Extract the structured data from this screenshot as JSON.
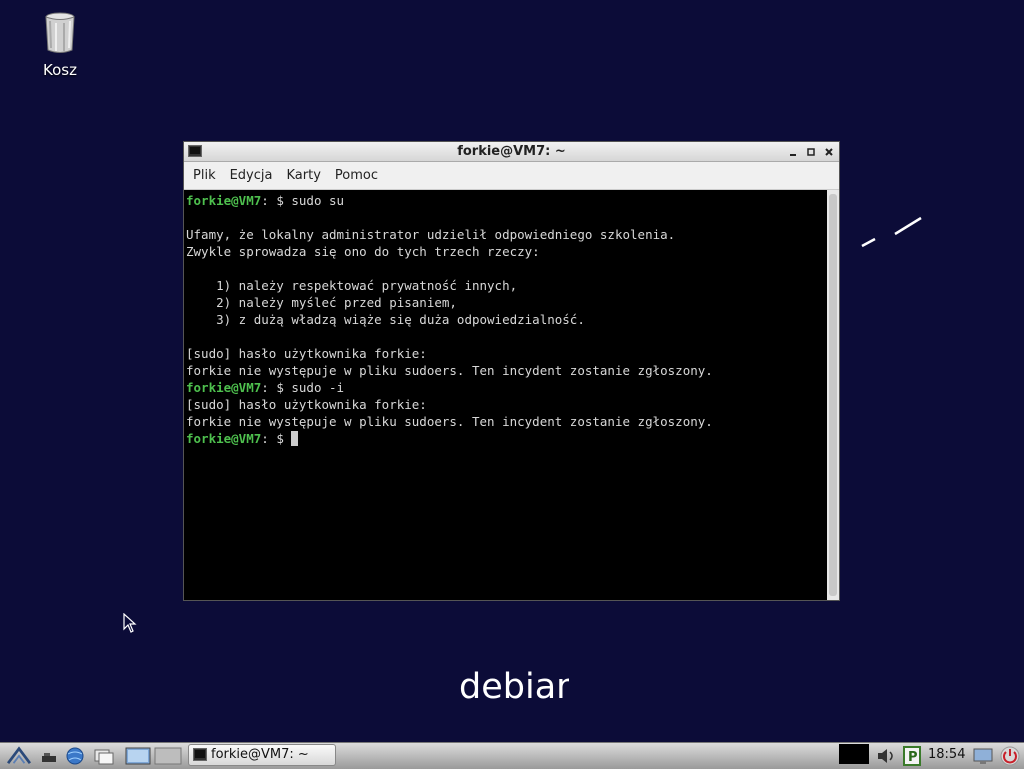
{
  "desktop": {
    "trash_label": "Kosz",
    "logo_text": "debian"
  },
  "window": {
    "title": "forkie@VM7: ~",
    "menu": [
      "Plik",
      "Edycja",
      "Karty",
      "Pomoc"
    ]
  },
  "terminal": {
    "prompt": "forkie@VM7",
    "prompt_sep": ": $ ",
    "lines": [
      {
        "prompt": true,
        "text": "sudo su"
      },
      {
        "prompt": false,
        "text": ""
      },
      {
        "prompt": false,
        "text": "Ufamy, że lokalny administrator udzielił odpowiedniego szkolenia."
      },
      {
        "prompt": false,
        "text": "Zwykle sprowadza się ono do tych trzech rzeczy:"
      },
      {
        "prompt": false,
        "text": ""
      },
      {
        "prompt": false,
        "text": "    1) należy respektować prywatność innych,"
      },
      {
        "prompt": false,
        "text": "    2) należy myśleć przed pisaniem,"
      },
      {
        "prompt": false,
        "text": "    3) z dużą władzą wiąże się duża odpowiedzialność."
      },
      {
        "prompt": false,
        "text": ""
      },
      {
        "prompt": false,
        "text": "[sudo] hasło użytkownika forkie:"
      },
      {
        "prompt": false,
        "text": "forkie nie występuje w pliku sudoers. Ten incydent zostanie zgłoszony."
      },
      {
        "prompt": true,
        "text": "sudo -i"
      },
      {
        "prompt": false,
        "text": "[sudo] hasło użytkownika forkie:"
      },
      {
        "prompt": false,
        "text": "forkie nie występuje w pliku sudoers. Ten incydent zostanie zgłoszony."
      },
      {
        "prompt": true,
        "text": "",
        "cursor": true
      }
    ]
  },
  "taskbar": {
    "task_label": "forkie@VM7: ~",
    "clock": "18:54"
  },
  "colors": {
    "desktop_bg": "#0c0c38",
    "prompt_green": "#4ec04e"
  }
}
